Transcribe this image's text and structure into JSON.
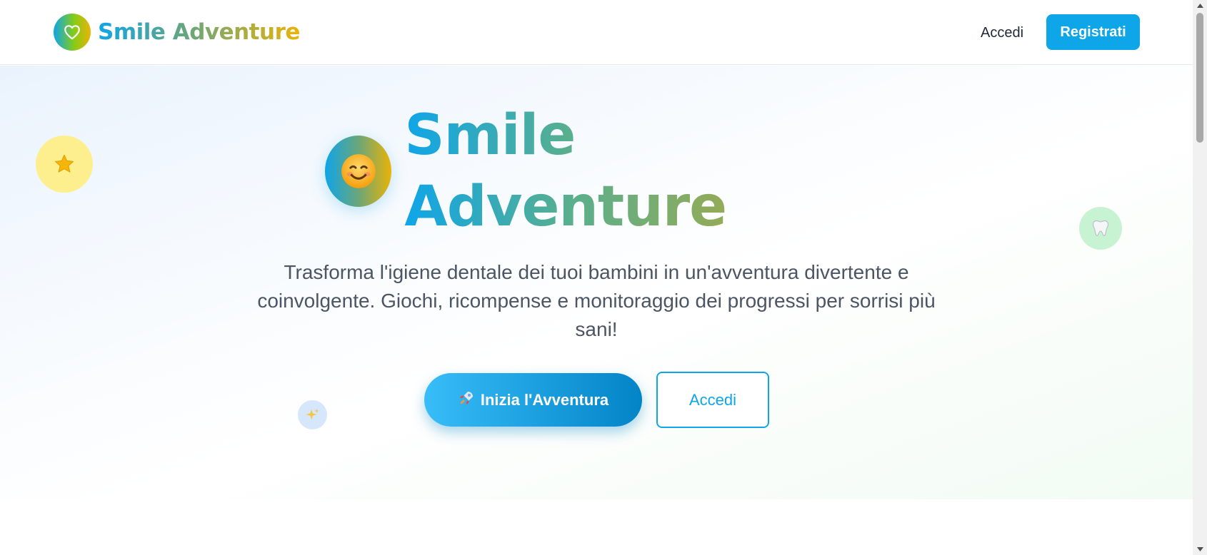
{
  "header": {
    "brand_name": "Smile Adventure",
    "login_label": "Accedi",
    "register_label": "Registrati"
  },
  "hero": {
    "title": "Smile Adventure",
    "face_emoji": "smiling-face-icon",
    "description": "Trasforma l'igiene dentale dei tuoi bambini in un'avventura divertente e coinvolgente. Giochi, ricompense e monitoraggio dei progressi per sorrisi più sani!",
    "primary_cta": {
      "icon": "rocket-icon",
      "label": "Inizia l'Avventura"
    },
    "secondary_cta_label": "Accedi",
    "decorations": [
      "star-icon",
      "tooth-icon",
      "sparkle-icon"
    ]
  },
  "colors": {
    "brand_blue": "#0ea5e9",
    "brand_yellow": "#eab308",
    "brand_green": "#6aa67a",
    "text_dark": "#1f2937",
    "text_body": "#4b5563"
  }
}
